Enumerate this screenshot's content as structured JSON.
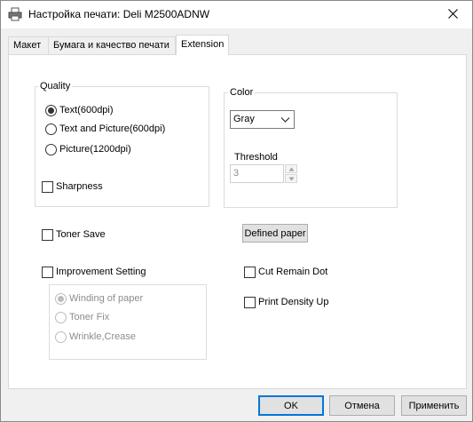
{
  "window": {
    "title": "Настройка печати: Deli M2500ADNW"
  },
  "tabs": [
    {
      "label": "Макет",
      "active": false
    },
    {
      "label": "Бумага и качество печати",
      "active": false
    },
    {
      "label": "Extension",
      "active": true
    }
  ],
  "quality": {
    "label": "Quality",
    "options": [
      {
        "label": "Text(600dpi)",
        "selected": true
      },
      {
        "label": "Text and Picture(600dpi)",
        "selected": false
      },
      {
        "label": "Picture(1200dpi)",
        "selected": false
      }
    ],
    "sharpness": {
      "label": "Sharpness",
      "checked": false
    }
  },
  "color": {
    "label": "Color",
    "select_value": "Gray",
    "threshold_label": "Threshold",
    "threshold_value": "3"
  },
  "toner_save": {
    "label": "Toner Save",
    "checked": false
  },
  "defined_paper_button": "Defined paper",
  "improvement": {
    "label": "Improvement Setting",
    "checked": false,
    "options": [
      {
        "label": "Winding of paper",
        "selected": true
      },
      {
        "label": "Toner Fix",
        "selected": false
      },
      {
        "label": "Wrinkle,Crease",
        "selected": false
      }
    ]
  },
  "cut_remain_dot": {
    "label": "Cut Remain Dot",
    "checked": false
  },
  "print_density_up": {
    "label": "Print Density Up",
    "checked": false
  },
  "buttons": {
    "ok": "OK",
    "cancel": "Отмена",
    "apply": "Применить"
  },
  "icons": {
    "title": "printer-icon",
    "close": "close-icon",
    "dropdown": "chevron-down-icon"
  }
}
